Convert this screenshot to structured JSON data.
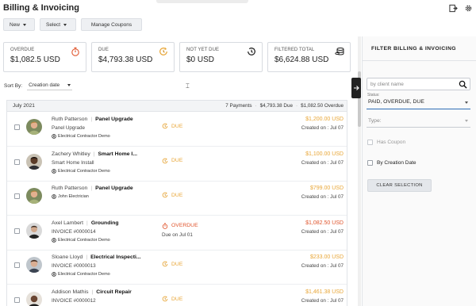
{
  "app": {
    "title": "Billing & Invoicing"
  },
  "toolbar": {
    "new_label": "New",
    "select_label": "Select",
    "manage_coupons_label": "Manage Coupons"
  },
  "cards": [
    {
      "label": "OVERDUE",
      "value": "$1,082.5 USD",
      "icon": "stopwatch-icon",
      "color": "#e0552d"
    },
    {
      "label": "DUE",
      "value": "$4,793.38 USD",
      "icon": "clock-refresh-icon",
      "color": "#e8a637"
    },
    {
      "label": "NOT YET DUE",
      "value": "$0 USD",
      "icon": "history-icon",
      "color": "#222222"
    },
    {
      "label": "FILTERED TOTAL",
      "value": "$6,624.88 USD",
      "icon": "coins-stack-icon",
      "color": "#222222"
    }
  ],
  "sort": {
    "label": "Sort By:",
    "value": "Creation date"
  },
  "list": {
    "month": "July 2021",
    "payments": "7 Payments",
    "due_total": "$4,793.38 Due",
    "overdue_total": "$1,082.50 Overdue",
    "rows": [
      {
        "client": "Ruth Patterson",
        "title": "Panel Upgrade",
        "subtitle": "Panel Upgrade",
        "company": "Electrical Contractor Demo",
        "status": "DUE",
        "status_kind": "due",
        "status_sub": "",
        "amount": "$1,200.00 USD",
        "created": "Created on : Jul 07",
        "avatar": "photo-a"
      },
      {
        "client": "Zachery Whitley",
        "title": "Smart Home I...",
        "subtitle": "Smart Home Install",
        "company": "Electrical Contractor Demo",
        "status": "DUE",
        "status_kind": "due",
        "status_sub": "",
        "amount": "$1,100.00 USD",
        "created": "Created on : Jul 07",
        "avatar": "photo-b"
      },
      {
        "client": "Ruth Patterson",
        "title": "Panel Upgrade",
        "subtitle": "",
        "company": "John Electrician",
        "status": "DUE",
        "status_kind": "due",
        "status_sub": "",
        "amount": "$799.00 USD",
        "created": "Created on : Jul 07",
        "avatar": "photo-a"
      },
      {
        "client": "Axel Lambert",
        "title": "Grounding",
        "subtitle": "INVOICE #0000014",
        "company": "Electrical Contractor Demo",
        "status": "OVERDUE",
        "status_kind": "overdue",
        "status_sub": "Due on Jul 01",
        "amount": "$1,082.50 USD",
        "created": "Created on : Jul 07",
        "avatar": "photo-c"
      },
      {
        "client": "Sloane Lloyd",
        "title": "Electrical Inspecti...",
        "subtitle": "INVOICE #0000013",
        "company": "Electrical Contractor Demo",
        "status": "DUE",
        "status_kind": "due",
        "status_sub": "",
        "amount": "$233.00 USD",
        "created": "Created on : Jul 07",
        "avatar": "photo-d"
      },
      {
        "client": "Addison Mathis",
        "title": "Circuit Repair",
        "subtitle": "INVOICE #0000012",
        "company": "",
        "status": "DUE",
        "status_kind": "due",
        "status_sub": "",
        "amount": "$1,461.38 USD",
        "created": "Created on : Jul 07",
        "avatar": "photo-e"
      }
    ]
  },
  "filter": {
    "title": "FILTER BILLING & INVOICING",
    "search_placeholder": "by client name",
    "status_label": "Status:",
    "status_value": "PAID, OVERDUE, DUE",
    "type_placeholder": "Type:",
    "has_coupon_label": "Has Coupon",
    "by_creation_date_label": "By Creation Date",
    "clear_label": "CLEAR SELECTION"
  },
  "colors": {
    "due": "#e8a637",
    "overdue": "#e0552d",
    "accent": "#2d6cb5"
  }
}
